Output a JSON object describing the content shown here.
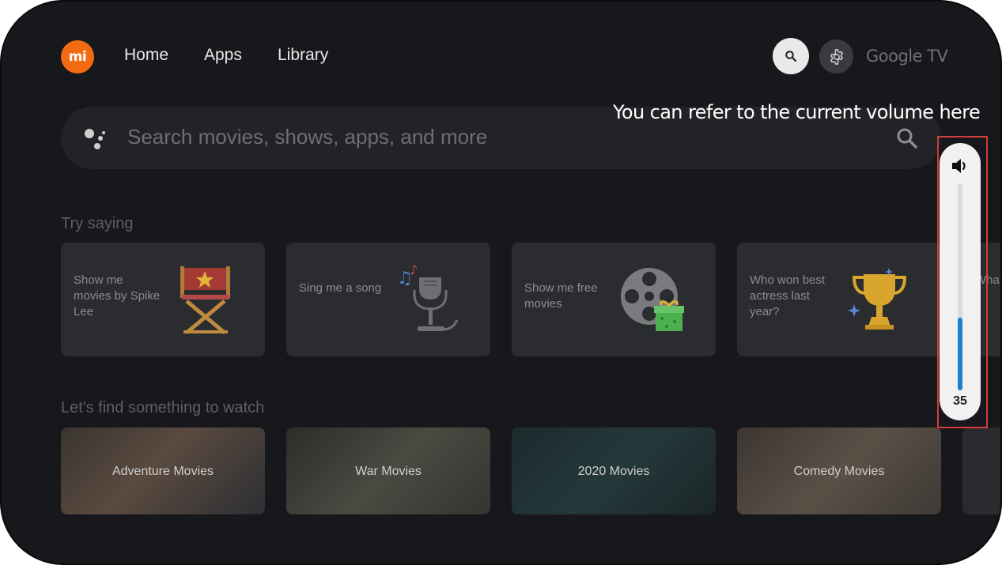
{
  "nav": {
    "home": "Home",
    "apps": "Apps",
    "library": "Library"
  },
  "brand": {
    "logo": "mi",
    "platform": "Google TV"
  },
  "search": {
    "placeholder": "Search movies, shows, apps, and more"
  },
  "callout": "You can refer to the current volume here",
  "try_saying": {
    "title": "Try saying",
    "cards": [
      {
        "text": "Show me movies by Spike Lee",
        "icon": "directors-chair-icon"
      },
      {
        "text": "Sing me a song",
        "icon": "microphone-music-icon"
      },
      {
        "text": "Show me free movies",
        "icon": "film-reel-gift-icon"
      },
      {
        "text": "Who won best actress last year?",
        "icon": "trophy-icon"
      },
      {
        "text": "What weat tomo",
        "icon": ""
      }
    ]
  },
  "watch": {
    "title": "Let's find something to watch",
    "cards": [
      {
        "label": "Adventure Movies"
      },
      {
        "label": "War Movies"
      },
      {
        "label": "2020 Movies"
      },
      {
        "label": "Comedy Movies"
      }
    ]
  },
  "volume": {
    "value": "35",
    "level": 0.35,
    "icon": "speaker-icon"
  },
  "colors": {
    "accent": "#1a7fd1",
    "logo": "#f26b12",
    "highlight": "#d23c3c"
  }
}
